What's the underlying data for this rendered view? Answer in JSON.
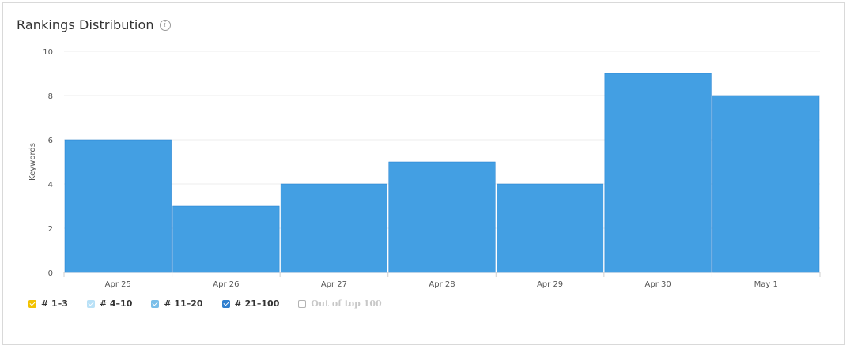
{
  "widget": {
    "title": "Rankings Distribution",
    "info_icon": "info-circle-icon"
  },
  "chart_data": {
    "type": "bar",
    "title": "Rankings Distribution",
    "xlabel": "",
    "ylabel": "Keywords",
    "ylim": [
      0,
      10
    ],
    "yticks": [
      0,
      2,
      4,
      6,
      8,
      10
    ],
    "categories": [
      "Apr 25",
      "Apr 26",
      "Apr 27",
      "Apr 28",
      "Apr 29",
      "Apr 30",
      "May 1"
    ],
    "series": [
      {
        "name": "# 21–100",
        "color": "#439fe3",
        "values": [
          6,
          3,
          4,
          5,
          4,
          9,
          8
        ]
      }
    ],
    "grid": true,
    "legend_position": "bottom-left"
  },
  "legend": [
    {
      "label": "# 1–3",
      "color": "#f2c200",
      "checked": true
    },
    {
      "label": "# 4–10",
      "color": "#b9e1f7",
      "checked": true
    },
    {
      "label": "# 11–20",
      "color": "#79bee9",
      "checked": true
    },
    {
      "label": "# 21–100",
      "color": "#2f7fcf",
      "checked": true
    },
    {
      "label": "Out of top 100",
      "color": "#b3b3b3",
      "checked": false
    }
  ]
}
